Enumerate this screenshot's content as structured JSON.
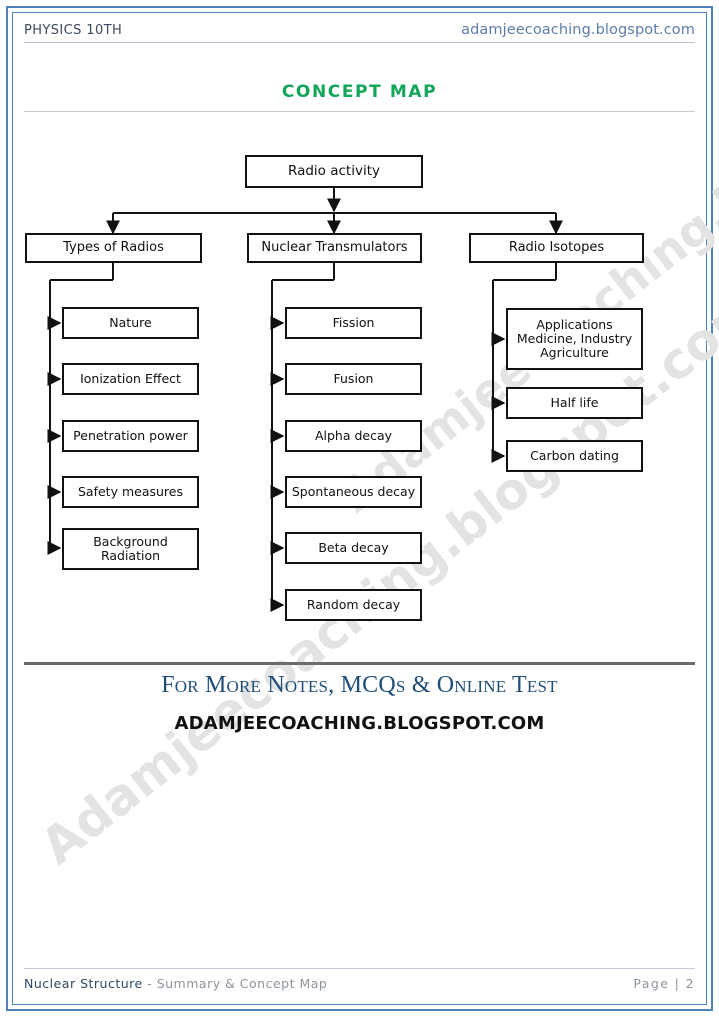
{
  "page": {
    "border_color": "#4f81bd",
    "watermark_text": "Adamjeecoaching.blogspot.com"
  },
  "header": {
    "left_label": "PHYSICS 10TH",
    "right_label": "adamjeecoaching.blogspot.com"
  },
  "title": {
    "text": "CONCEPT MAP",
    "color": "#11a65a"
  },
  "diagram": {
    "root": {
      "label": "Radio activity"
    },
    "branches": [
      {
        "label": "Types of Radios",
        "children": [
          {
            "label": "Nature"
          },
          {
            "label": "Ionization Effect"
          },
          {
            "label": "Penetration power"
          },
          {
            "label": "Safety measures"
          },
          {
            "label": "Background\nRadiation"
          }
        ]
      },
      {
        "label": "Nuclear Transmulators",
        "children": [
          {
            "label": "Fission"
          },
          {
            "label": "Fusion"
          },
          {
            "label": "Alpha decay"
          },
          {
            "label": "Spontaneous decay"
          },
          {
            "label": "Beta decay"
          },
          {
            "label": "Random decay"
          }
        ]
      },
      {
        "label": "Radio Isotopes",
        "children": [
          {
            "label": "Applications\nMedicine, Industry\nAgriculture"
          },
          {
            "label": "Half life"
          },
          {
            "label": "Carbon dating"
          }
        ]
      }
    ]
  },
  "promo": {
    "line1": "For More Notes, MCQs & Online Test",
    "line2": "ADAMJEECOACHING.BLOGSPOT.COM",
    "line1_color": "#1f4e79"
  },
  "footer": {
    "chapter": "Nuclear Structure",
    "separator": " - ",
    "subtitle": "Summary & Concept Map",
    "page_label": "Page | 2"
  }
}
